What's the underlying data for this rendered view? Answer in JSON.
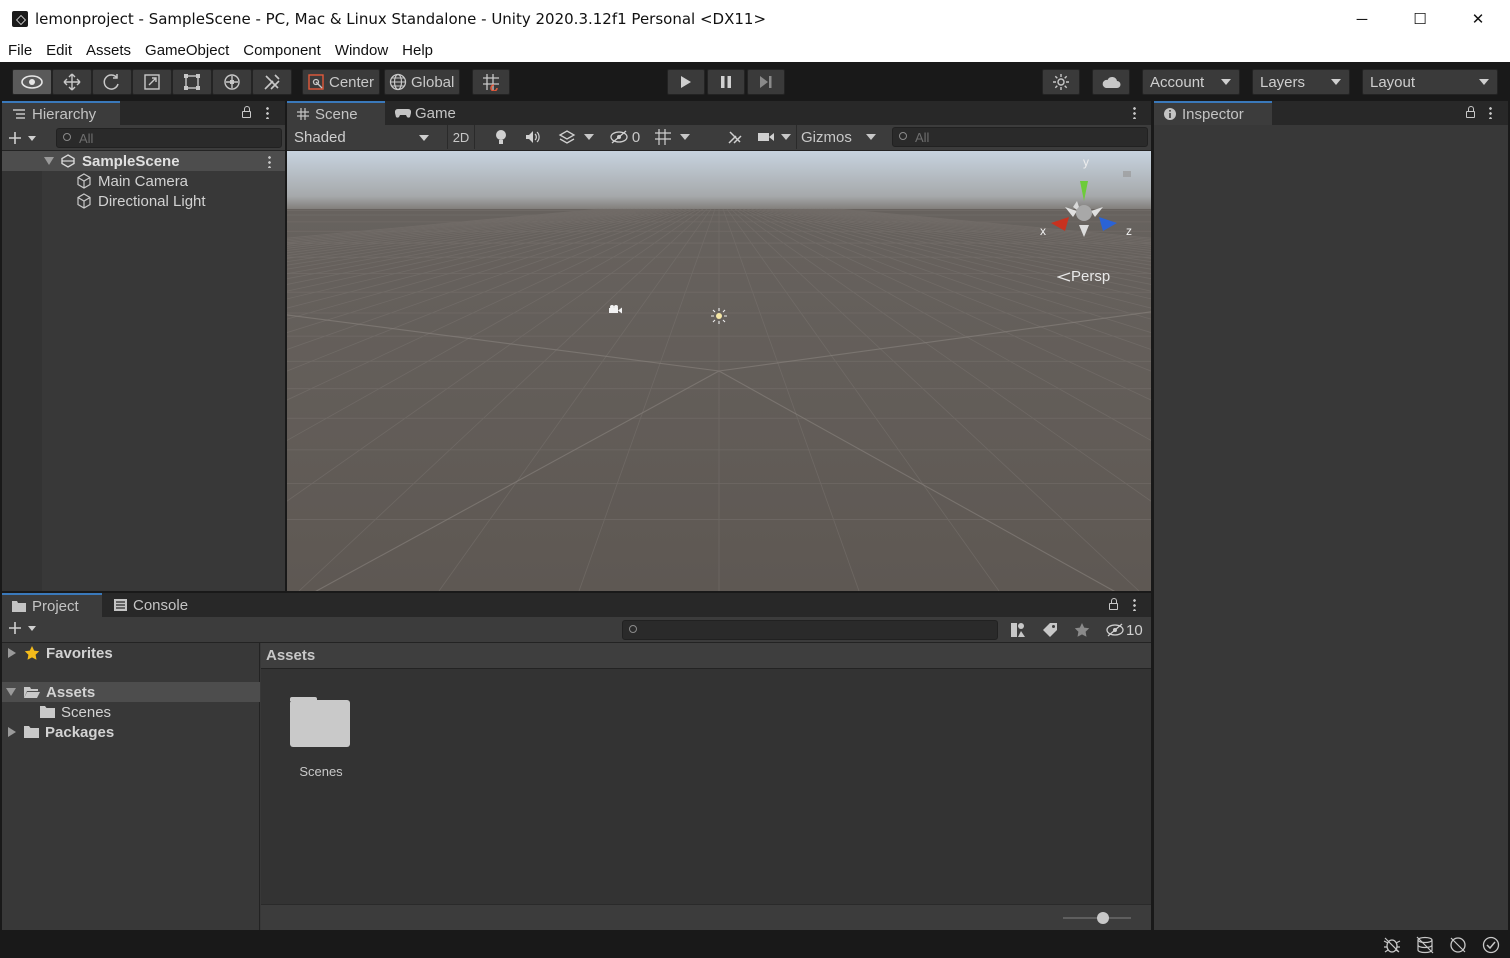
{
  "window": {
    "title": "lemonproject - SampleScene - PC, Mac & Linux Standalone - Unity 2020.3.12f1 Personal <DX11>",
    "minimize": "─",
    "maximize": "☐",
    "close": "✕"
  },
  "menu": [
    "File",
    "Edit",
    "Assets",
    "GameObject",
    "Component",
    "Window",
    "Help"
  ],
  "toolbar": {
    "center_label": "Center",
    "global_label": "Global",
    "account_label": "Account",
    "layers_label": "Layers",
    "layout_label": "Layout"
  },
  "hierarchy": {
    "tab_label": "Hierarchy",
    "search_placeholder": "All",
    "scene_name": "SampleScene",
    "items": [
      "Main Camera",
      "Directional Light"
    ]
  },
  "scene_view": {
    "tabs": [
      "Scene",
      "Game"
    ],
    "shading_mode": "Shaded",
    "mode_2d": "2D",
    "hidden_count": "0",
    "gizmos_label": "Gizmos",
    "search_placeholder": "All",
    "projection_label": "Persp",
    "axis_x": "x",
    "axis_y": "y",
    "axis_z": "z",
    "sky_color": "#c9d6e2",
    "ground_color": "#5e5853"
  },
  "inspector": {
    "tab_label": "Inspector"
  },
  "project": {
    "tabs": [
      "Project",
      "Console"
    ],
    "hidden_packages_count": "10",
    "tree": {
      "favorites": "Favorites",
      "assets": "Assets",
      "scenes": "Scenes",
      "packages": "Packages"
    },
    "breadcrumb": "Assets",
    "grid_items": [
      "Scenes"
    ]
  },
  "colors": {
    "accent": "#3a79bb",
    "panel_bg": "#383838",
    "selection": "#4d4d4d"
  }
}
